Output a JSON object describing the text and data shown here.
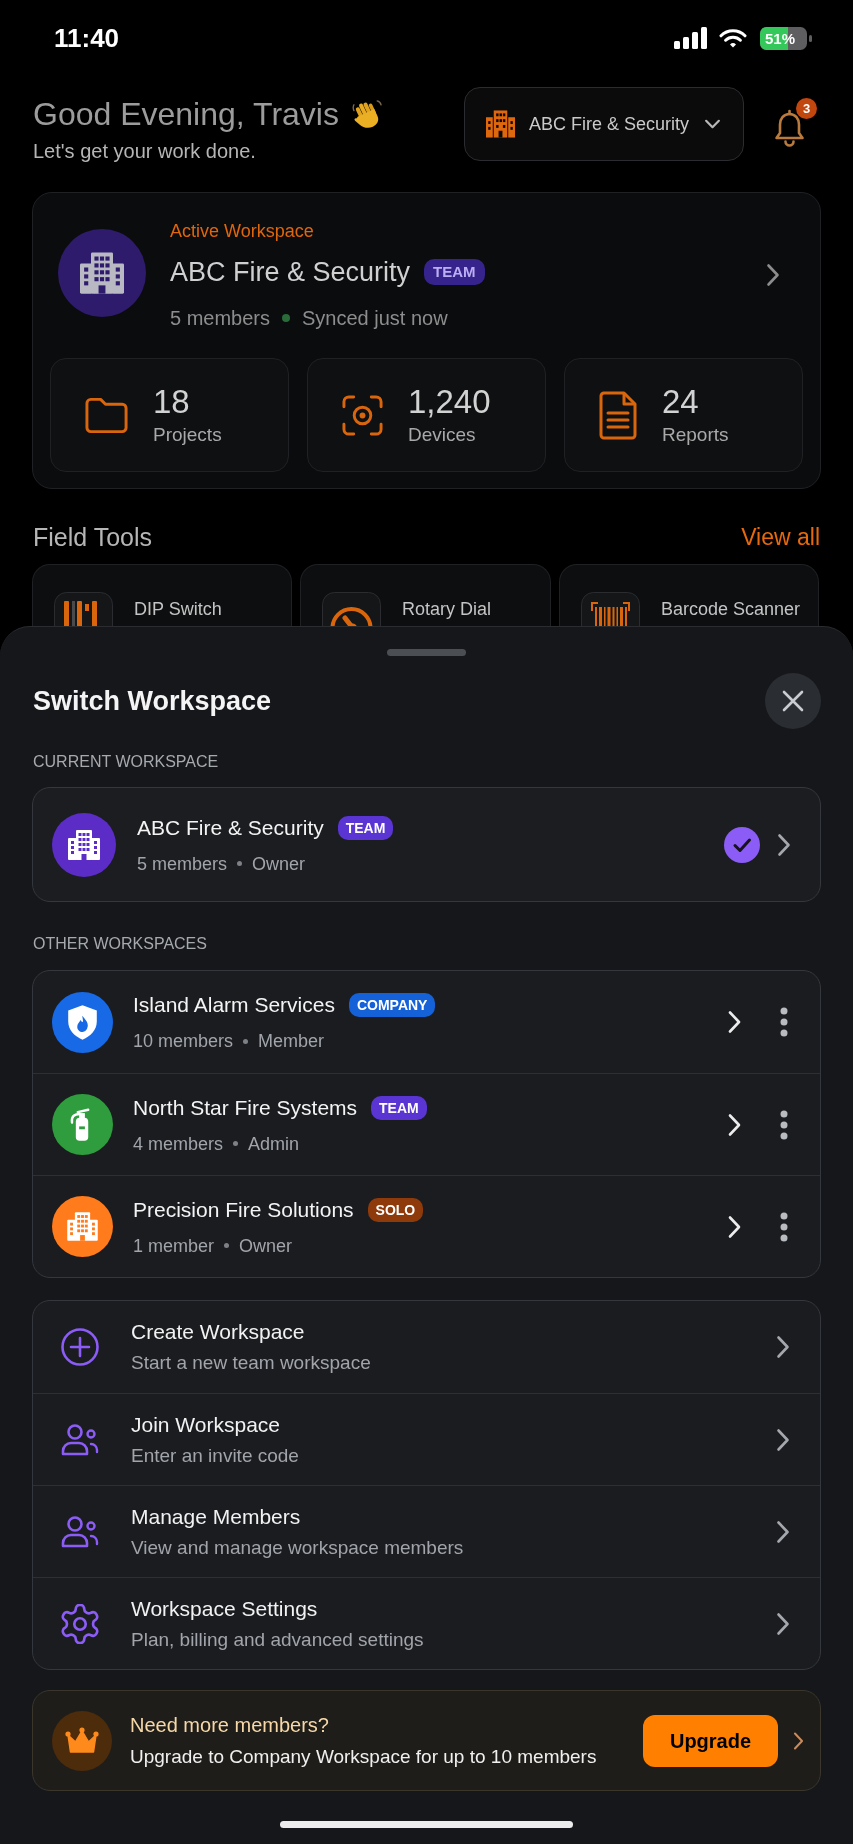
{
  "status_bar": {
    "time": "11:40",
    "battery": "51%"
  },
  "header": {
    "greeting": "Good Evening, Travis",
    "subtitle": "Let's get your work done.",
    "workspace_picker": "ABC Fire & Security",
    "notification_count": "3"
  },
  "active_workspace": {
    "eyebrow": "Active Workspace",
    "name": "ABC Fire & Security",
    "plan": "TEAM",
    "members": "5 members",
    "sync_status": "Synced just now",
    "stats": [
      {
        "kind": "projects",
        "value": "18",
        "label": "Projects"
      },
      {
        "kind": "devices",
        "value": "1,240",
        "label": "Devices"
      },
      {
        "kind": "reports",
        "value": "24",
        "label": "Reports"
      }
    ]
  },
  "field_tools": {
    "title": "Field Tools",
    "link": "View all",
    "tools": [
      {
        "kind": "dip_switch",
        "label": "DIP Switch"
      },
      {
        "kind": "rotary_dial",
        "label": "Rotary Dial"
      },
      {
        "kind": "barcode",
        "label": "Barcode Scanner"
      }
    ]
  },
  "sheet": {
    "title": "Switch Workspace",
    "current": {
      "heading": "CURRENT WORKSPACE",
      "workspace": {
        "name": "ABC Fire & Security",
        "plan": {
          "label": "TEAM",
          "color": "#5a35d4"
        },
        "members": "5 members",
        "role": "Owner",
        "avatar": {
          "kind": "building",
          "color": "#5b2cc6"
        },
        "selected": true
      }
    },
    "other": {
      "heading": "OTHER WORKSPACES",
      "workspaces": [
        {
          "name": "Island Alarm Services",
          "plan": {
            "label": "COMPANY",
            "color": "#1561d8"
          },
          "members": "10 members",
          "role": "Member",
          "avatar": {
            "kind": "shield",
            "color": "#1769e6"
          },
          "selected": false
        },
        {
          "name": "North Star Fire Systems",
          "plan": {
            "label": "TEAM",
            "color": "#5a35d4"
          },
          "members": "4 members",
          "role": "Admin",
          "avatar": {
            "kind": "extinguisher",
            "color": "#2f9d3d"
          },
          "selected": false
        },
        {
          "name": "Precision Fire Solutions",
          "plan": {
            "label": "SOLO",
            "color": "#8e3a0b"
          },
          "members": "1 member",
          "role": "Owner",
          "avatar": {
            "kind": "building",
            "color": "#ff7b1c"
          },
          "selected": false
        }
      ]
    },
    "actions": [
      {
        "kind": "create",
        "title": "Create Workspace",
        "subtitle": "Start a new team workspace"
      },
      {
        "kind": "join",
        "title": "Join Workspace",
        "subtitle": "Enter an invite code"
      },
      {
        "kind": "members",
        "title": "Manage Members",
        "subtitle": "View and manage workspace members"
      },
      {
        "kind": "settings",
        "title": "Workspace Settings",
        "subtitle": "Plan, billing and advanced settings"
      }
    ],
    "upsell": {
      "title": "Need more members?",
      "text": "Upgrade to Company Workspace for up to 10 members",
      "button": "Upgrade"
    }
  }
}
